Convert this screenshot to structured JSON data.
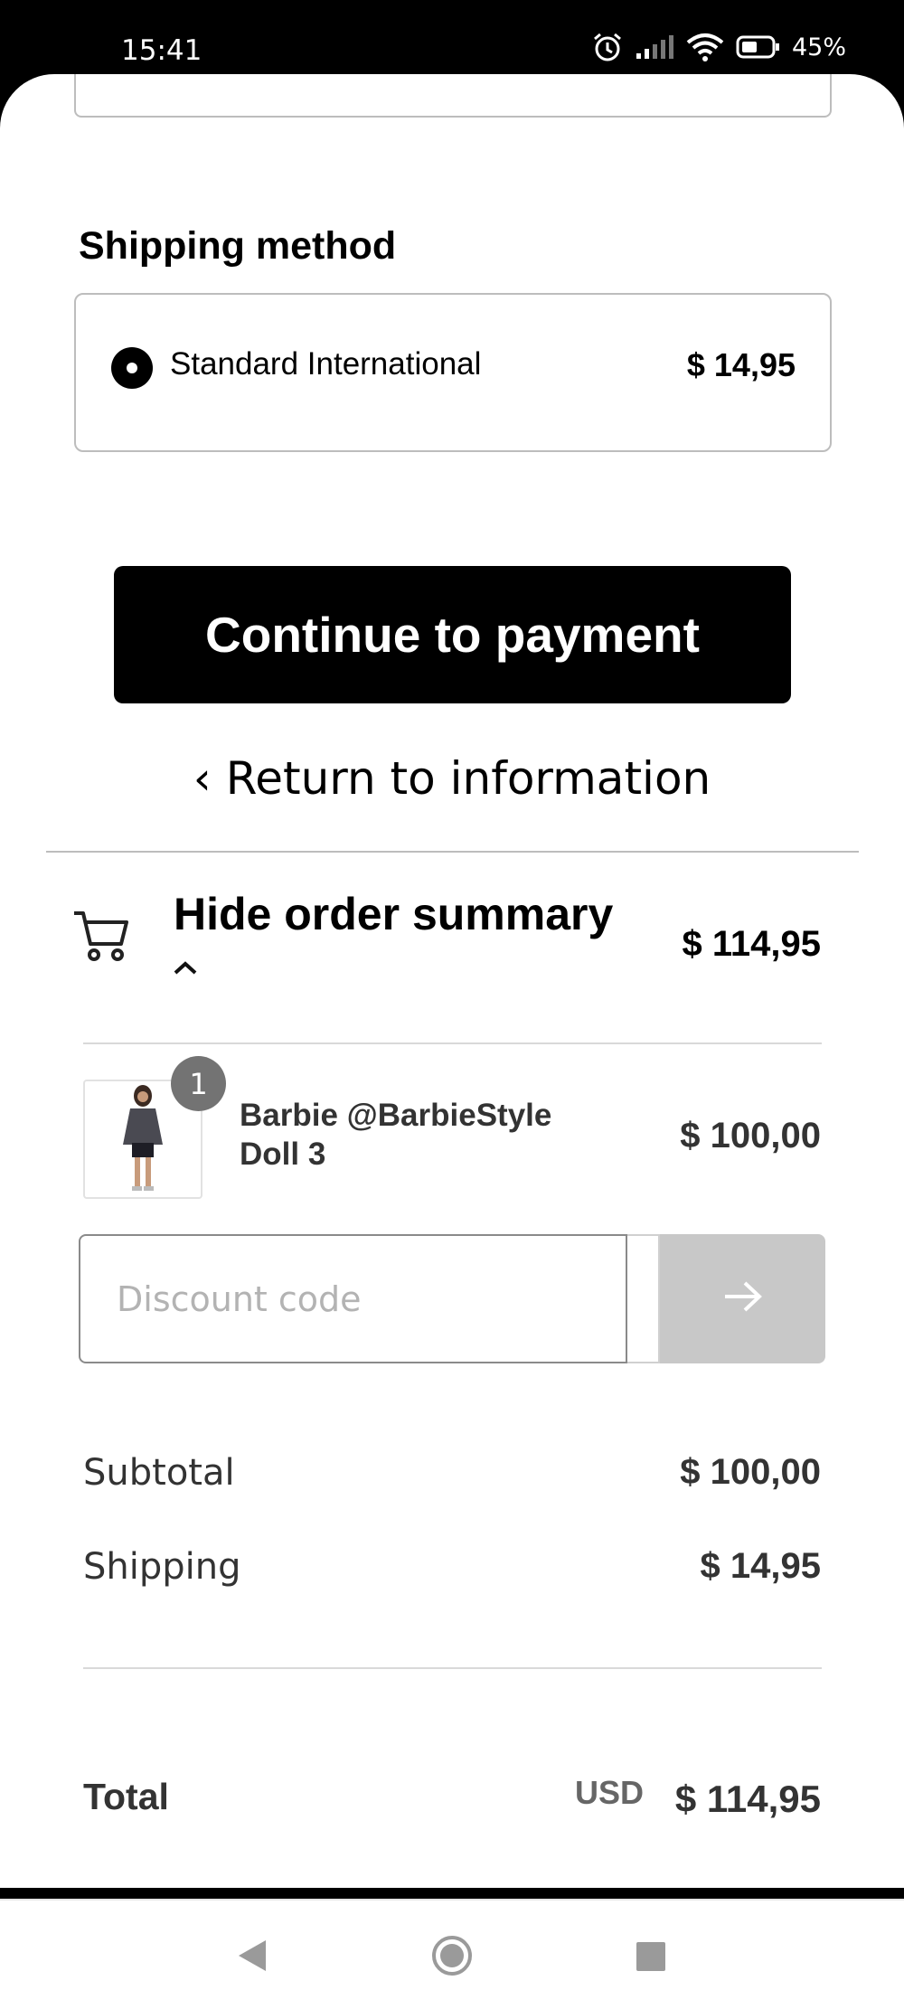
{
  "status_bar": {
    "time": "15:41",
    "battery": "45%",
    "icons": [
      "alarm-icon",
      "signal-icon",
      "wifi-icon",
      "battery-icon"
    ]
  },
  "shipping": {
    "section_title": "Shipping method",
    "options": [
      {
        "name": "Standard International",
        "price": "$ 14,95",
        "selected": true
      }
    ]
  },
  "actions": {
    "continue_label": "Continue to payment",
    "return_label": "Return to information"
  },
  "order_summary": {
    "toggle_label": "Hide order summary",
    "total": "$ 114,95",
    "items": [
      {
        "quantity": "1",
        "name": "Barbie @BarbieStyle Doll 3",
        "price": "$ 100,00"
      }
    ],
    "discount_placeholder": "Discount code",
    "subtotal_label": "Subtotal",
    "subtotal_value": "$ 100,00",
    "shipping_label": "Shipping",
    "shipping_value": "$ 14,95",
    "total_label": "Total",
    "currency": "USD",
    "total_value": "$ 114,95"
  },
  "colors": {
    "primary_button": "#000000",
    "disabled_button": "#c8c8c8",
    "badge": "#737373",
    "border": "#bdbdbd"
  }
}
